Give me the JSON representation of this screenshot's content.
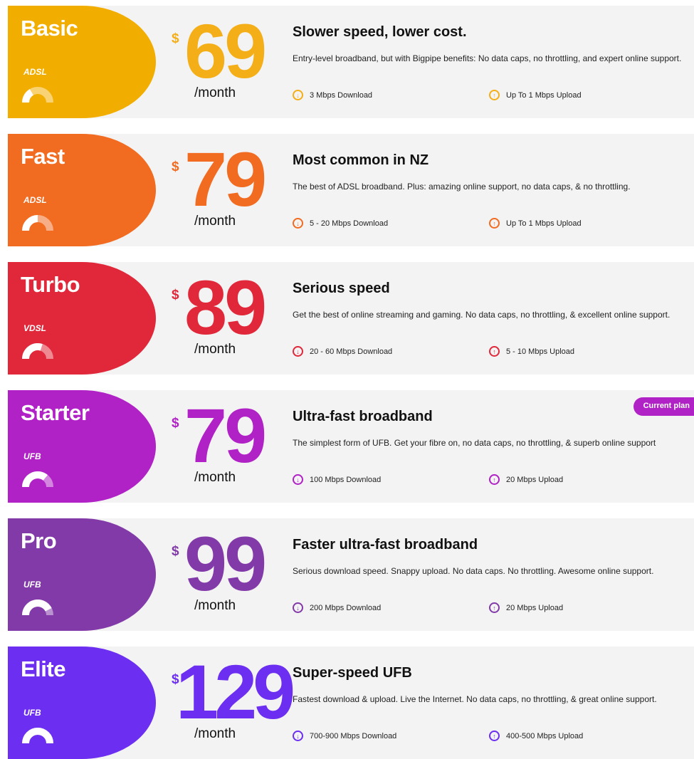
{
  "plans": [
    {
      "name": "Basic",
      "tech": "ADSL",
      "price": "69",
      "currency": "$",
      "per": "/month",
      "headline": "Slower speed, lower cost.",
      "desc": "Entry-level broadband, but with Bigpipe benefits: No data caps, no throttling, and expert online support.",
      "download": "3 Mbps Download",
      "upload": "Up To 1 Mbps Upload",
      "color": "#f2ae00",
      "price_color": "#f4ae17",
      "level": 0.33
    },
    {
      "name": "Fast",
      "tech": "ADSL",
      "price": "79",
      "currency": "$",
      "per": "/month",
      "headline": "Most common in NZ",
      "desc": "The best of ADSL broadband. Plus: amazing online support, no data caps, & no throttling.",
      "download": "5 - 20 Mbps Download",
      "upload": "Up To 1 Mbps Upload",
      "color": "#f16b21",
      "price_color": "#f16b21",
      "level": 0.5
    },
    {
      "name": "Turbo",
      "tech": "VDSL",
      "price": "89",
      "currency": "$",
      "per": "/month",
      "headline": "Serious speed",
      "desc": "Get the best of online streaming and gaming. No data caps, no throttling, & excellent online support.",
      "download": "20 - 60 Mbps Download",
      "upload": "5 - 10 Mbps Upload",
      "color": "#e0283a",
      "price_color": "#e0283a",
      "level": 0.6
    },
    {
      "name": "Starter",
      "tech": "UFB",
      "price": "79",
      "currency": "$",
      "per": "/month",
      "headline": "Ultra-fast broadband",
      "desc": "The simplest form of UFB. Get your fibre on, no data caps, no throttling, & superb online support",
      "download": "100 Mbps Download",
      "upload": "20 Mbps Upload",
      "color": "#b021c6",
      "price_color": "#b021c6",
      "level": 0.72,
      "badge": "Current plan"
    },
    {
      "name": "Pro",
      "tech": "UFB",
      "price": "99",
      "currency": "$",
      "per": "/month",
      "headline": "Faster ultra-fast broadband",
      "desc": "Serious download speed. Snappy upload. No data caps. No throttling. Awesome online support.",
      "download": "200 Mbps Download",
      "upload": "20 Mbps Upload",
      "color": "#823aa8",
      "price_color": "#823aa8",
      "level": 0.85
    },
    {
      "name": "Elite",
      "tech": "UFB",
      "price": "129",
      "currency": "$",
      "per": "/month",
      "headline": "Super-speed UFB",
      "desc": "Fastest download & upload. Live the Internet. No data caps, no throttling, & great online support.",
      "download": "700-900 Mbps Download",
      "upload": "400-500 Mbps Upload",
      "color": "#6c2ef0",
      "price_color": "#6c2ef0",
      "level": 1.0
    }
  ],
  "icons": {
    "download": "arrow-down-circle-icon",
    "upload": "arrow-up-circle-icon",
    "gauge": "speed-gauge-icon"
  }
}
